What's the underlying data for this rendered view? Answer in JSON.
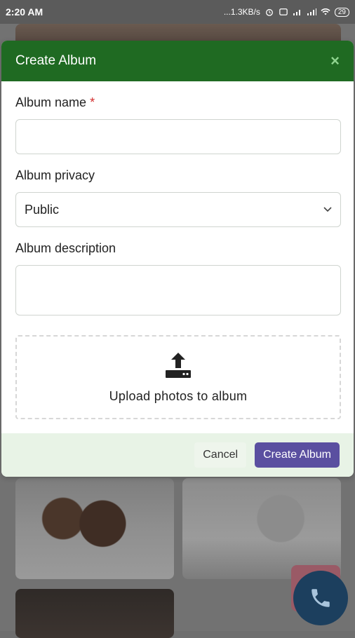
{
  "status_bar": {
    "time": "2:20 AM",
    "speed": "...1.3KB/s",
    "battery": "29"
  },
  "modal": {
    "title": "Create Album",
    "close_symbol": "×",
    "album_name_label": "Album name",
    "required_marker": "*",
    "album_privacy_label": "Album privacy",
    "album_privacy_value": "Public",
    "album_description_label": "Album description",
    "upload_text": "Upload photos to album",
    "cancel_label": "Cancel",
    "create_label": "Create Album"
  },
  "colors": {
    "header_green": "#1f6a22",
    "create_button": "#5a4fa0",
    "footer_bg": "#e8f3e6"
  }
}
